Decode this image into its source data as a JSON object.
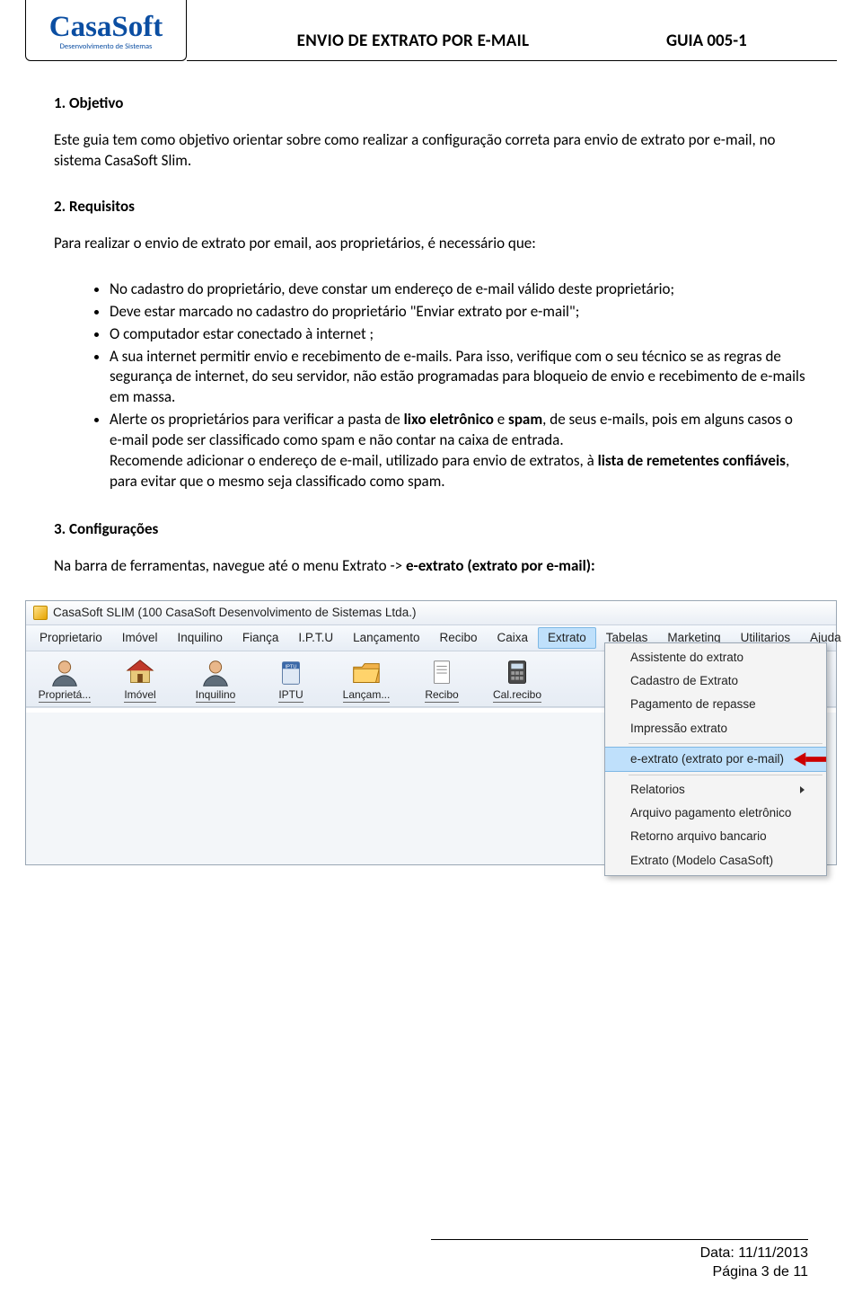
{
  "header": {
    "logo_name": "CasaSoft",
    "logo_sub": "Desenvolvimento de Sistemas",
    "doc_title": "ENVIO DE EXTRATO POR E-MAIL",
    "doc_code": "GUIA 005-1"
  },
  "sections": {
    "s1_h": "1.   Objetivo",
    "s1_p": "Este guia tem como objetivo orientar sobre como realizar a configuração correta para envio de extrato por e-mail, no sistema CasaSoft Slim.",
    "s2_h": "2.   Requisitos",
    "s2_p": "Para realizar o envio de extrato por email, aos proprietários, é necessário que:",
    "b1": "No cadastro do proprietário, deve constar um endereço de e-mail válido deste proprietário;",
    "b2": "Deve estar marcado no cadastro do proprietário \"Enviar extrato por e-mail\";",
    "b3": "O computador estar conectado à internet ;",
    "b4": "A sua internet permitir envio e recebimento de e-mails. Para isso, verifique com o seu técnico se as regras de segurança de internet, do seu servidor, não estão programadas para bloqueio de envio e recebimento de e-mails em massa.",
    "b5_a": "Alerte os proprietários para verificar a pasta de ",
    "b5_b": "lixo eletrônico",
    "b5_c": " e ",
    "b5_d": "spam",
    "b5_e": ", de seus e-mails, pois em alguns casos o e-mail pode ser classificado como spam e não contar na caixa de entrada.",
    "b5_f": "Recomende adicionar o endereço de e-mail, utilizado para envio de extratos, à ",
    "b5_g": "lista de remetentes confiáveis",
    "b5_h": ", para evitar que o mesmo seja classificado como spam.",
    "s3_h": "3.   Configurações",
    "s3_p_a": "Na barra de ferramentas, navegue até o menu Extrato -> ",
    "s3_p_b": "e-extrato (extrato por e-mail):"
  },
  "app": {
    "title": "CasaSoft SLIM (100 CasaSoft Desenvolvimento de Sistemas Ltda.)",
    "menus": [
      "Proprietario",
      "Imóvel",
      "Inquilino",
      "Fiança",
      "I.P.T.U",
      "Lançamento",
      "Recibo",
      "Caixa",
      "Extrato",
      "Tabelas",
      "Marketing",
      "Utilitarios",
      "Ajuda"
    ],
    "active_menu_index": 8,
    "toolbar": [
      {
        "label": "Proprietá..."
      },
      {
        "label": "Imóvel"
      },
      {
        "label": "Inquilino"
      },
      {
        "label": "IPTU"
      },
      {
        "label": "Lançam..."
      },
      {
        "label": "Recibo"
      },
      {
        "label": "Cal.recibo"
      }
    ],
    "dropdown": [
      {
        "label": "Assistente do extrato",
        "sep": false,
        "hl": false,
        "sub": false
      },
      {
        "label": "Cadastro de Extrato",
        "sep": false,
        "hl": false,
        "sub": false
      },
      {
        "label": "Pagamento de repasse",
        "sep": false,
        "hl": false,
        "sub": false
      },
      {
        "label": "Impressão extrato",
        "sep": true,
        "hl": false,
        "sub": false
      },
      {
        "label": "e-extrato (extrato por e-mail)",
        "sep": true,
        "hl": true,
        "sub": false,
        "arrow": true
      },
      {
        "label": "Relatorios",
        "sep": false,
        "hl": false,
        "sub": true
      },
      {
        "label": "Arquivo pagamento eletrônico",
        "sep": false,
        "hl": false,
        "sub": false
      },
      {
        "label": "Retorno arquivo bancario",
        "sep": false,
        "hl": false,
        "sub": false
      },
      {
        "label": "Extrato (Modelo CasaSoft)",
        "sep": false,
        "hl": false,
        "sub": false
      }
    ]
  },
  "footer": {
    "date_label": "Data: ",
    "date": "11/11/2013",
    "page_label": "Página ",
    "page": "3",
    "page_of": " de ",
    "total": "11"
  }
}
